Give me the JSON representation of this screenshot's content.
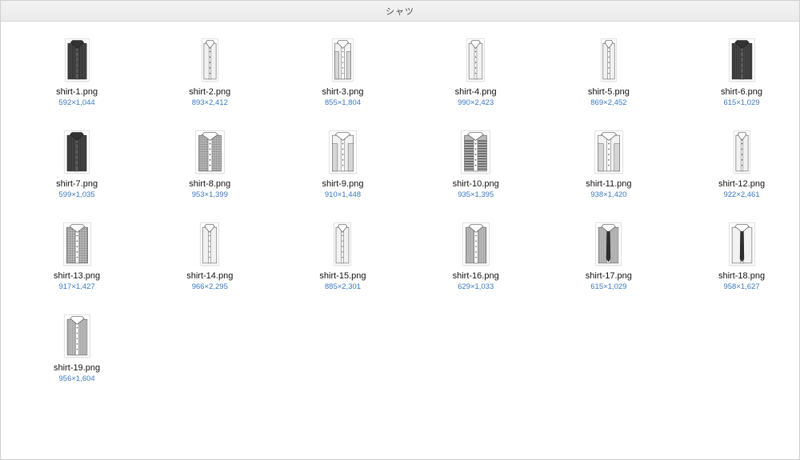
{
  "window": {
    "title": "シャツ"
  },
  "colors": {
    "dimension_text": "#3a78c2",
    "filename_text": "#111111"
  },
  "files": [
    {
      "name": "shirt-1.png",
      "dims": "592×1,044",
      "style": "dark-stripe"
    },
    {
      "name": "shirt-2.png",
      "dims": "893×2,412",
      "style": "light-plain"
    },
    {
      "name": "shirt-3.png",
      "dims": "855×1,804",
      "style": "light-vest"
    },
    {
      "name": "shirt-4.png",
      "dims": "990×2,423",
      "style": "light-plain"
    },
    {
      "name": "shirt-5.png",
      "dims": "869×2,452",
      "style": "light-plain"
    },
    {
      "name": "shirt-6.png",
      "dims": "615×1,029",
      "style": "dark-plain"
    },
    {
      "name": "shirt-7.png",
      "dims": "599×1,035",
      "style": "dark-plain"
    },
    {
      "name": "shirt-8.png",
      "dims": "953×1,399",
      "style": "medium-check"
    },
    {
      "name": "shirt-9.png",
      "dims": "910×1,448",
      "style": "light-vest"
    },
    {
      "name": "shirt-10.png",
      "dims": "935×1,395",
      "style": "wide-stripe"
    },
    {
      "name": "shirt-11.png",
      "dims": "938×1,420",
      "style": "light-vest"
    },
    {
      "name": "shirt-12.png",
      "dims": "922×2,461",
      "style": "light-plain"
    },
    {
      "name": "shirt-13.png",
      "dims": "917×1,427",
      "style": "medium-check"
    },
    {
      "name": "shirt-14.png",
      "dims": "966×2,295",
      "style": "light-plain"
    },
    {
      "name": "shirt-15.png",
      "dims": "885×2,301",
      "style": "light-plain"
    },
    {
      "name": "shirt-16.png",
      "dims": "629×1,033",
      "style": "medium-plain"
    },
    {
      "name": "shirt-17.png",
      "dims": "615×1,029",
      "style": "medium-tie"
    },
    {
      "name": "shirt-18.png",
      "dims": "958×1,627",
      "style": "light-tie"
    },
    {
      "name": "shirt-19.png",
      "dims": "956×1,604",
      "style": "medium-plain"
    }
  ]
}
